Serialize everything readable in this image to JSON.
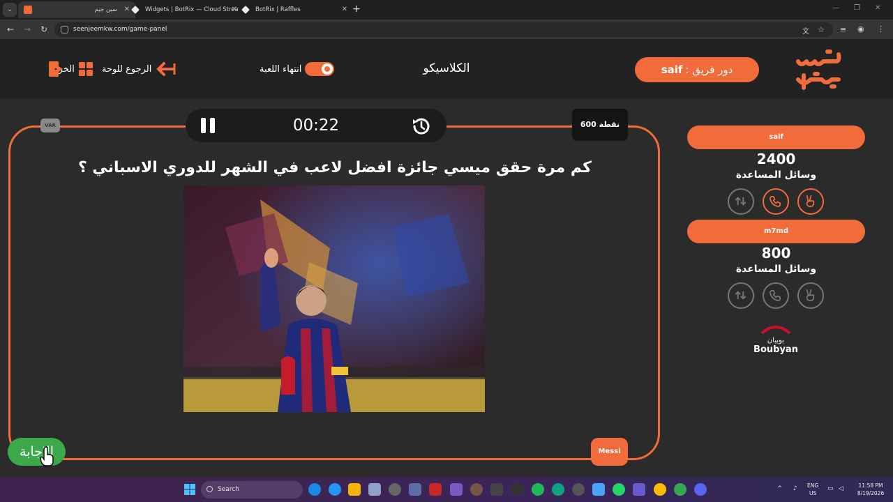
{
  "browser": {
    "tabs": [
      {
        "title": "سين جيم",
        "active": true
      },
      {
        "title": "Widgets | BotRix — Cloud Strea",
        "active": false
      },
      {
        "title": "BotRix | Raffles",
        "active": false
      }
    ],
    "new_tab": "+",
    "url": "seenjeemkw.com/game-panel",
    "window_controls": {
      "minimize": "—",
      "restore": "❐",
      "close": "✕"
    }
  },
  "header": {
    "team_turn_label": "دور فريق :",
    "team_turn_name": "saif",
    "game_title": "الكلاسيكو",
    "end_game_label": "انتهاء اللعبة",
    "back_to_board_label": "الرجوع للوحة",
    "exit_label": "الخروج"
  },
  "question_panel": {
    "var_badge": "VAR",
    "timer": "00:22",
    "points": "600 نقطة",
    "question": "كم مرة حقق ميسي جائزة افضل لاعب في الشهر للدوري الاسباني ؟",
    "image_caption": "",
    "answer_hint": "Messi",
    "answer_button": "الإجابة"
  },
  "teams": [
    {
      "name": "saif",
      "score": "2400",
      "aids_label": "وسائل المساعدة",
      "aids": [
        {
          "icon": "swap-icon",
          "active": false
        },
        {
          "icon": "phone-icon",
          "active": true
        },
        {
          "icon": "peace-hand-icon",
          "active": true
        }
      ]
    },
    {
      "name": "m7md",
      "score": "800",
      "aids_label": "وسائل المساعدة",
      "aids": [
        {
          "icon": "swap-icon",
          "active": false
        },
        {
          "icon": "phone-icon",
          "active": false
        },
        {
          "icon": "peace-hand-icon",
          "active": false
        }
      ]
    }
  ],
  "sponsor": {
    "arabic": "بوبيان",
    "latin": "Boubyan"
  },
  "taskbar": {
    "search_placeholder": "Search",
    "lang": "ENG",
    "region": "US",
    "time": "11:58 PM",
    "date": "8/19/2026"
  },
  "colors": {
    "accent": "#f26b3a",
    "answer_green": "#3ba84a",
    "background": "#2b2b2b",
    "header": "#222222"
  }
}
